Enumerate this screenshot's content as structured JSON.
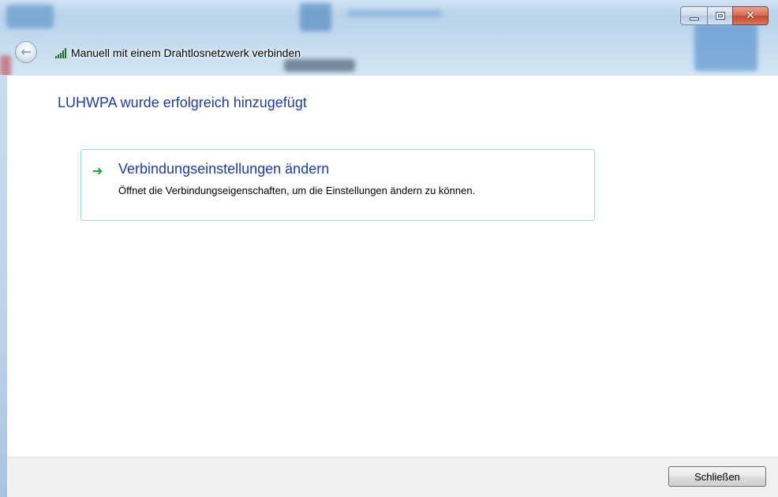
{
  "window": {
    "title_buttons": {
      "minimize_icon": "minimize-icon",
      "maximize_icon": "maximize-icon",
      "close_glyph": "✕"
    }
  },
  "navigation": {
    "back_glyph": "←"
  },
  "header": {
    "title": "Manuell mit einem Drahtlosnetzwerk verbinden",
    "icon": "wireless-signal-icon"
  },
  "main": {
    "heading": "LUHWPA wurde erfolgreich hinzugefügt",
    "task": {
      "arrow_glyph": "➔",
      "title": "Verbindungseinstellungen ändern",
      "description": "Öffnet die Verbindungseigenschaften, um die Einstellungen ändern zu können."
    }
  },
  "footer": {
    "close_label": "Schließen"
  },
  "colors": {
    "heading_blue": "#1e3e96",
    "task_border": "#9dd7ef",
    "arrow_green": "#1c9b2b",
    "close_red": "#c34a30"
  }
}
